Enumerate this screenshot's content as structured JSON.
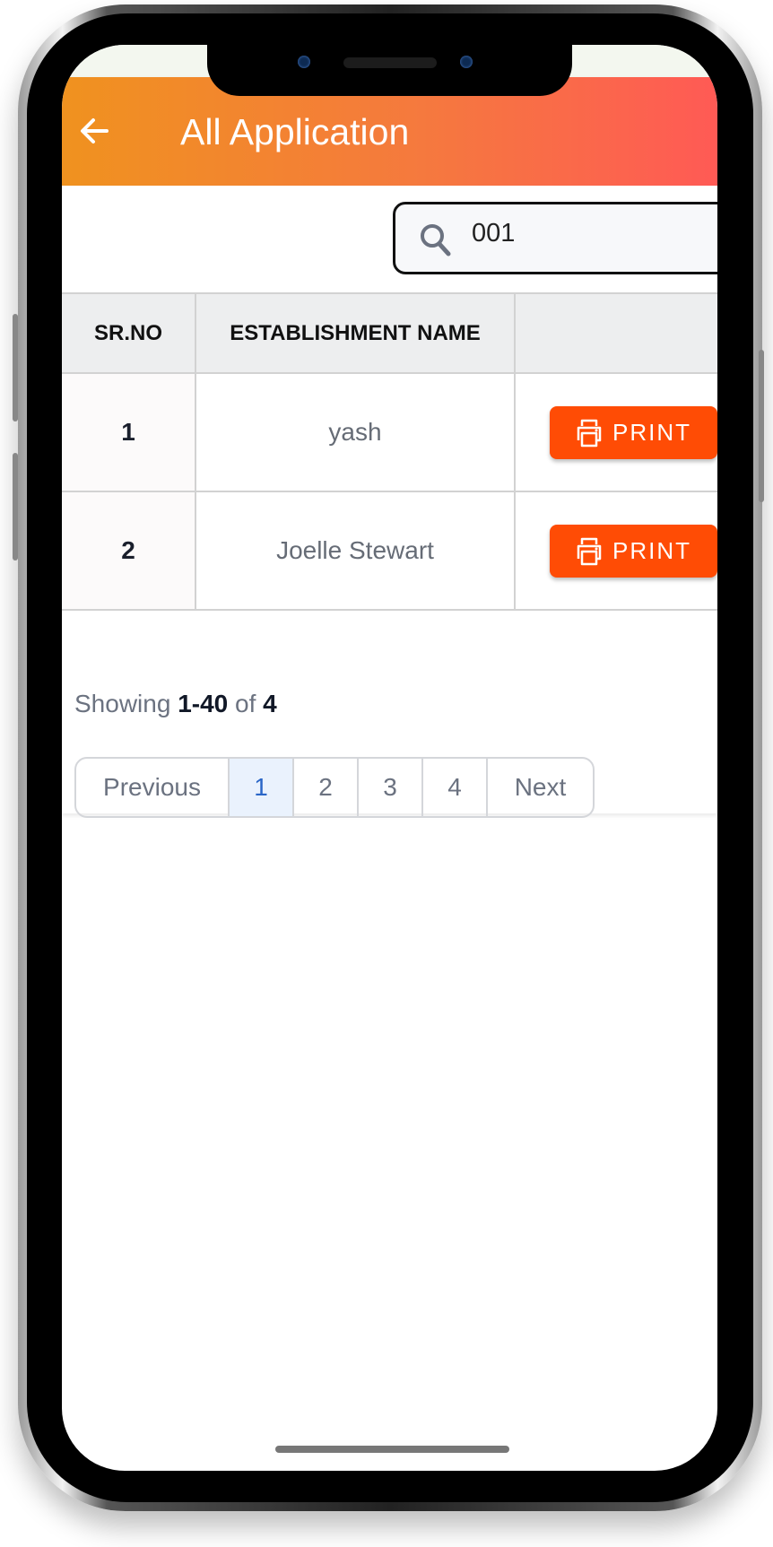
{
  "header": {
    "title": "All Application",
    "back_icon": "arrow-left-icon"
  },
  "search": {
    "value": "001",
    "icon": "search-icon"
  },
  "table": {
    "columns": [
      "SR.NO",
      "ESTABLISHMENT NAME",
      ""
    ],
    "rows": [
      {
        "sr": "1",
        "name": "yash",
        "action": "PRINT"
      },
      {
        "sr": "2",
        "name": "Joelle Stewart",
        "action": "PRINT"
      }
    ]
  },
  "summary": {
    "prefix": "Showing",
    "range": "1-40",
    "of": "of",
    "total": "4"
  },
  "pagination": {
    "previous": "Previous",
    "pages": [
      "1",
      "2",
      "3",
      "4"
    ],
    "current": "1",
    "next": "Next"
  },
  "colors": {
    "header_start": "#f0921f",
    "header_end": "#ff5a55",
    "print_button": "#ff4c05",
    "active_page": "#2a66c7"
  }
}
